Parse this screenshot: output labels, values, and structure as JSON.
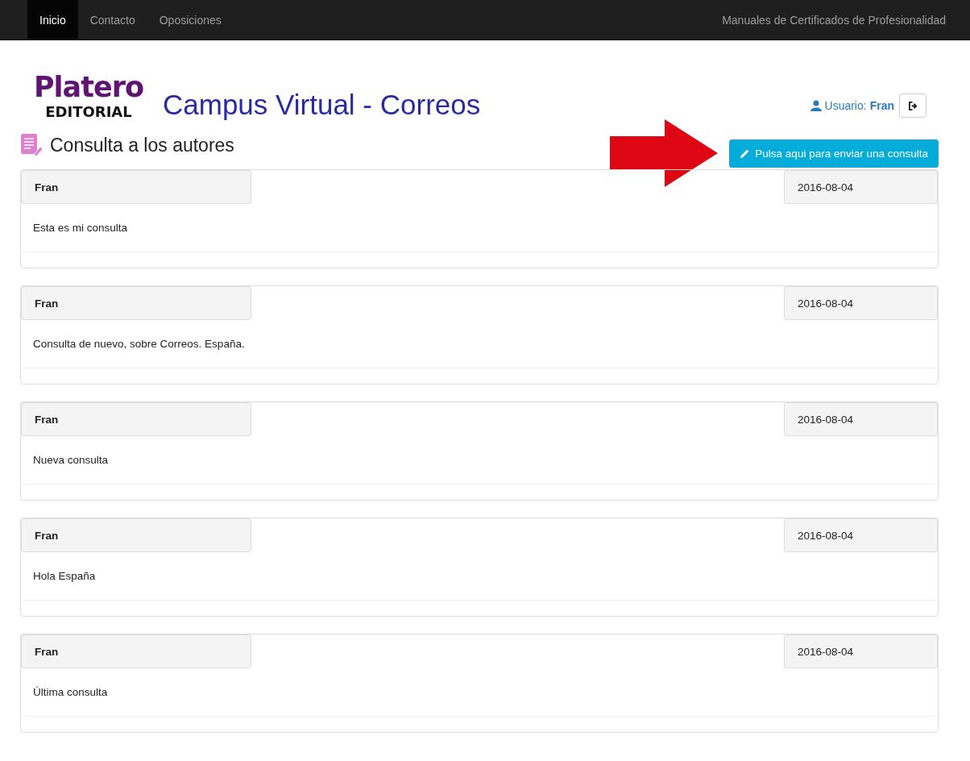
{
  "navbar": {
    "items": [
      {
        "label": "Inicio",
        "selected": true
      },
      {
        "label": "Contacto",
        "selected": false
      },
      {
        "label": "Oposiciones",
        "selected": false
      }
    ],
    "right_link": "Manuales de Certificados de Profesionalidad"
  },
  "header": {
    "logo_top": "Platero",
    "logo_bottom": "EDITORIAL",
    "title": "Campus Virtual - Correos",
    "user_label": "Usuario:",
    "user_name": "Fran"
  },
  "section": {
    "title": "Consulta a los autores",
    "button": "Pulsa aqui para enviar una consulta"
  },
  "queries": [
    {
      "author": "Fran",
      "date": "2016-08-04",
      "text": "Esta es mi consulta"
    },
    {
      "author": "Fran",
      "date": "2016-08-04",
      "text": "Consulta de nuevo, sobre Correos. España."
    },
    {
      "author": "Fran",
      "date": "2016-08-04",
      "text": "Nueva consulta"
    },
    {
      "author": "Fran",
      "date": "2016-08-04",
      "text": "Hola España"
    },
    {
      "author": "Fran",
      "date": "2016-08-04",
      "text": "Última consulta"
    }
  ]
}
